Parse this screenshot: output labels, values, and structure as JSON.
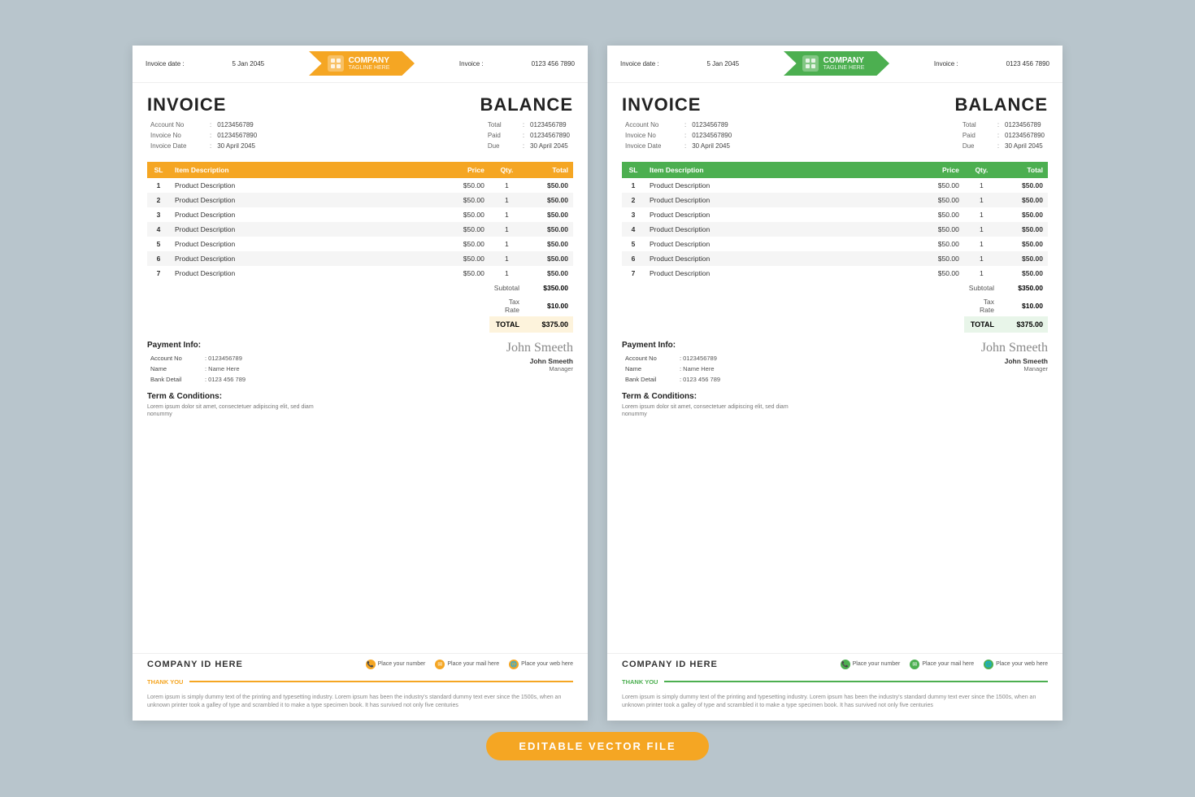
{
  "page": {
    "bg_color": "#b0bec5",
    "banner_label": "EDITABLE VECTOR FILE"
  },
  "invoice_left": {
    "header": {
      "date_label": "Invoice date :",
      "date_value": "5 Jan 2045",
      "invoice_label": "Invoice :",
      "invoice_value": "0123 456 7890",
      "company_name": "COMPANY",
      "company_tagline": "TAGLINE HERE",
      "accent_color": "orange"
    },
    "invoice_section": {
      "title": "INVOICE",
      "account_no_label": "Account No",
      "account_no_value": "0123456789",
      "invoice_no_label": "Invoice No",
      "invoice_no_value": "01234567890",
      "invoice_date_label": "Invoice Date",
      "invoice_date_value": "30 April 2045"
    },
    "balance_section": {
      "title": "BALANCE",
      "total_label": "Total",
      "total_value": "0123456789",
      "paid_label": "Paid",
      "paid_value": "01234567890",
      "due_label": "Due",
      "due_value": "30 April 2045"
    },
    "table": {
      "headers": [
        "SL",
        "Item Description",
        "Price",
        "Qty.",
        "Total"
      ],
      "rows": [
        {
          "sl": "1",
          "desc": "Product Description",
          "price": "$50.00",
          "qty": "1",
          "total": "$50.00"
        },
        {
          "sl": "2",
          "desc": "Product Description",
          "price": "$50.00",
          "qty": "1",
          "total": "$50.00"
        },
        {
          "sl": "3",
          "desc": "Product Description",
          "price": "$50.00",
          "qty": "1",
          "total": "$50.00"
        },
        {
          "sl": "4",
          "desc": "Product Description",
          "price": "$50.00",
          "qty": "1",
          "total": "$50.00"
        },
        {
          "sl": "5",
          "desc": "Product Description",
          "price": "$50.00",
          "qty": "1",
          "total": "$50.00"
        },
        {
          "sl": "6",
          "desc": "Product Description",
          "price": "$50.00",
          "qty": "1",
          "total": "$50.00"
        },
        {
          "sl": "7",
          "desc": "Product Description",
          "price": "$50.00",
          "qty": "1",
          "total": "$50.00"
        }
      ],
      "subtotal_label": "Subtotal",
      "subtotal_value": "$350.00",
      "taxrate_label": "Tax Rate",
      "taxrate_value": "$10.00",
      "total_label": "TOTAL",
      "total_value": "$375.00"
    },
    "payment_info": {
      "title": "Payment Info:",
      "account_no_label": "Account No",
      "account_no_value": ": 0123456789",
      "name_label": "Name",
      "name_value": ": Name Here",
      "bank_label": "Bank Detail",
      "bank_value": ": 0123 456 789"
    },
    "terms": {
      "title": "Term & Conditions:",
      "text": "Lorem ipsum dolor sit amet, consectetuer adipiscing elit, sed diam nonummy"
    },
    "signature": {
      "script": "John Smeeth",
      "name": "John Smeeth",
      "title": "Manager"
    },
    "footer": {
      "company_id": "COMPANY ID HERE",
      "phone_label": "Place your number",
      "email_label": "Place your mail here",
      "web_label": "Place your web here"
    },
    "thankyou": {
      "label": "THANK YOU"
    },
    "bottom_text": "Lorem ipsum is simply dummy text of the printing and typesetting industry. Lorem ipsum has been the industry's standard dummy text ever since the 1500s, when an unknown printer took a galley of type and scrambled it to make a type specimen book. It has survived not only five centuries"
  },
  "invoice_right": {
    "header": {
      "date_label": "Invoice date :",
      "date_value": "5 Jan 2045",
      "invoice_label": "Invoice :",
      "invoice_value": "0123 456 7890",
      "company_name": "COMPANY",
      "company_tagline": "TAGLINE HERE",
      "accent_color": "green"
    },
    "invoice_section": {
      "title": "INVOICE",
      "account_no_label": "Account No",
      "account_no_value": "0123456789",
      "invoice_no_label": "Invoice No",
      "invoice_no_value": "01234567890",
      "invoice_date_label": "Invoice Date",
      "invoice_date_value": "30 April 2045"
    },
    "balance_section": {
      "title": "BALANCE",
      "total_label": "Total",
      "total_value": "0123456789",
      "paid_label": "Paid",
      "paid_value": "01234567890",
      "due_label": "Due",
      "due_value": "30 April 2045"
    },
    "table": {
      "headers": [
        "SL",
        "Item Description",
        "Price",
        "Qty.",
        "Total"
      ],
      "rows": [
        {
          "sl": "1",
          "desc": "Product Description",
          "price": "$50.00",
          "qty": "1",
          "total": "$50.00"
        },
        {
          "sl": "2",
          "desc": "Product Description",
          "price": "$50.00",
          "qty": "1",
          "total": "$50.00"
        },
        {
          "sl": "3",
          "desc": "Product Description",
          "price": "$50.00",
          "qty": "1",
          "total": "$50.00"
        },
        {
          "sl": "4",
          "desc": "Product Description",
          "price": "$50.00",
          "qty": "1",
          "total": "$50.00"
        },
        {
          "sl": "5",
          "desc": "Product Description",
          "price": "$50.00",
          "qty": "1",
          "total": "$50.00"
        },
        {
          "sl": "6",
          "desc": "Product Description",
          "price": "$50.00",
          "qty": "1",
          "total": "$50.00"
        },
        {
          "sl": "7",
          "desc": "Product Description",
          "price": "$50.00",
          "qty": "1",
          "total": "$50.00"
        }
      ],
      "subtotal_label": "Subtotal",
      "subtotal_value": "$350.00",
      "taxrate_label": "Tax Rate",
      "taxrate_value": "$10.00",
      "total_label": "TOTAL",
      "total_value": "$375.00"
    },
    "payment_info": {
      "title": "Payment Info:",
      "account_no_label": "Account No",
      "account_no_value": ": 0123456789",
      "name_label": "Name",
      "name_value": ": Name Here",
      "bank_label": "Bank Detail",
      "bank_value": ": 0123 456 789"
    },
    "terms": {
      "title": "Term & Conditions:",
      "text": "Lorem ipsum dolor sit amet, consectetuer adipiscing elit, sed diam nonummy"
    },
    "signature": {
      "script": "John Smeeth",
      "name": "John Smeeth",
      "title": "Manager"
    },
    "footer": {
      "company_id": "COMPANY ID HERE",
      "phone_label": "Place your number",
      "email_label": "Place your mail here",
      "web_label": "Place your web here"
    },
    "thankyou": {
      "label": "THANK YOU"
    },
    "bottom_text": "Lorem ipsum is simply dummy text of the printing and typesetting industry. Lorem ipsum has been the industry's standard dummy text ever since the 1500s, when an unknown printer took a galley of type and scrambled it to make a type specimen book. It has survived not only five centuries"
  }
}
